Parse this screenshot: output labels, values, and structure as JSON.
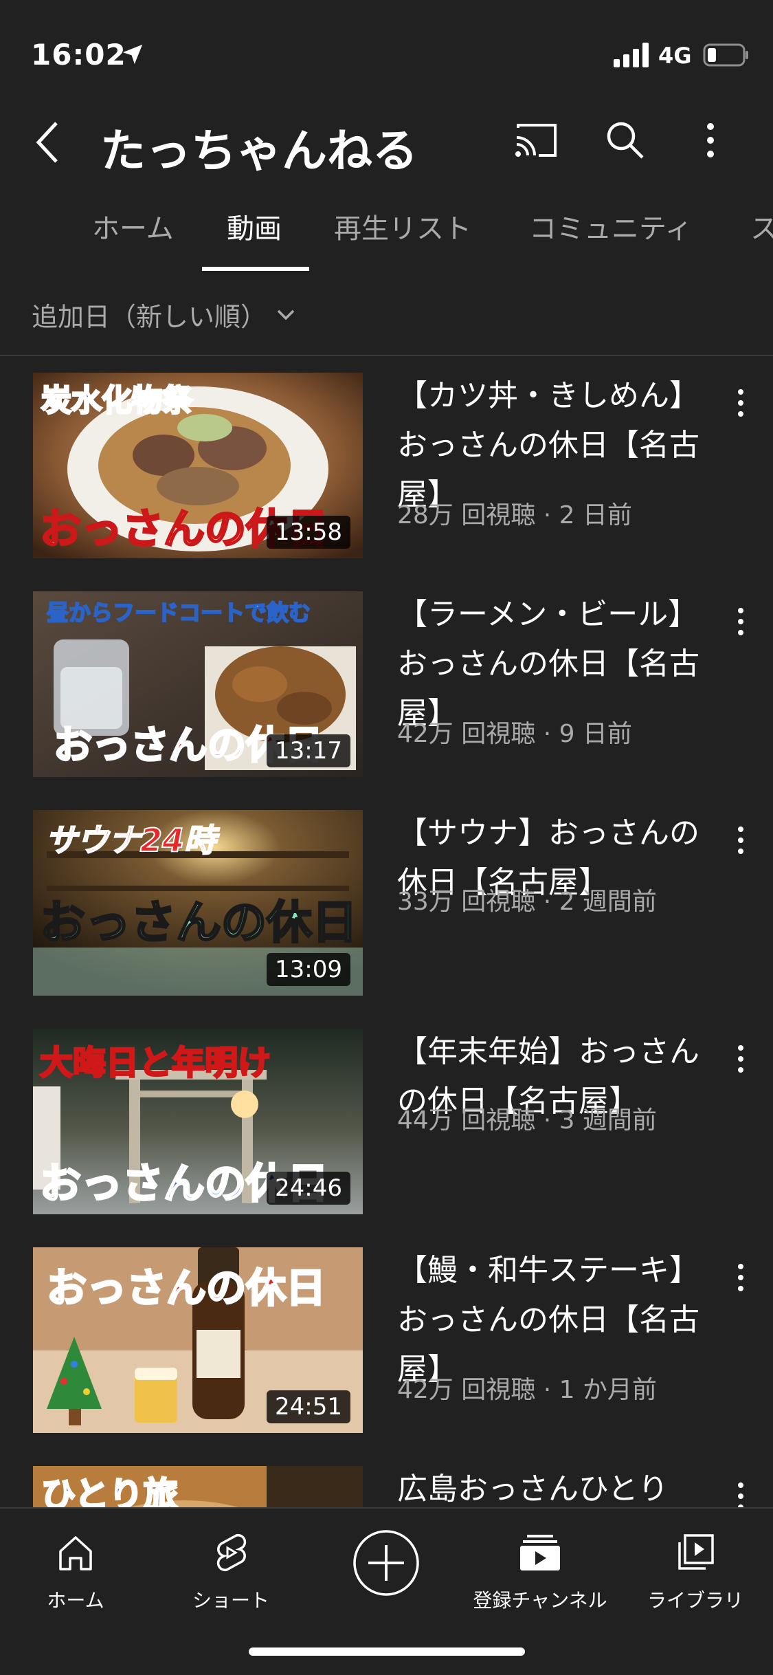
{
  "status": {
    "time": "16:02",
    "network": "4G"
  },
  "header": {
    "channel_name": "たっちゃんねる"
  },
  "tabs": [
    {
      "label": "ホーム"
    },
    {
      "label": "動画"
    },
    {
      "label": "再生リスト"
    },
    {
      "label": "コミュニティ"
    },
    {
      "label": "ス"
    }
  ],
  "sort": {
    "label": "追加日（新しい順）"
  },
  "videos": [
    {
      "title": "【カツ丼・きしめん】おっさんの休日【名古屋】",
      "meta": "28万 回視聴 · 2 日前",
      "duration": "13:58",
      "thumb_caption_top": "炭水化物祭",
      "thumb_caption_bottom": "おっさんの休日"
    },
    {
      "title": "【ラーメン・ビール】おっさんの休日【名古屋】",
      "meta": "42万 回視聴 · 9 日前",
      "duration": "13:17",
      "thumb_caption_top": "昼からフードコートで飲む",
      "thumb_caption_bottom": "おっさんの休日"
    },
    {
      "title": "【サウナ】おっさんの休日【名古屋】",
      "meta": "33万 回視聴 · 2 週間前",
      "duration": "13:09",
      "thumb_caption_top": "サウナ24時",
      "thumb_caption_bottom": "おっさんの休日"
    },
    {
      "title": "【年末年始】おっさんの休日【名古屋】",
      "meta": "44万 回視聴 · 3 週間前",
      "duration": "24:46",
      "thumb_caption_top": "大晦日と年明け",
      "thumb_caption_bottom": "おっさんの休日"
    },
    {
      "title": "【鰻・和牛ステーキ】おっさんの休日【名古屋】",
      "meta": "42万 回視聴 · 1 か月前",
      "duration": "24:51",
      "thumb_caption_top": "おっさんの休日",
      "thumb_caption_bottom": ""
    },
    {
      "title": "広島おっさんひとり",
      "meta": "",
      "duration": "",
      "thumb_caption_top": "ひとり旅",
      "thumb_caption_bottom": ""
    }
  ],
  "bottom_nav": [
    {
      "label": "ホーム",
      "icon": "home-icon"
    },
    {
      "label": "ショート",
      "icon": "shorts-icon"
    },
    {
      "label": "",
      "icon": "create-icon"
    },
    {
      "label": "登録チャンネル",
      "icon": "subscriptions-icon"
    },
    {
      "label": "ライブラリ",
      "icon": "library-icon"
    }
  ]
}
